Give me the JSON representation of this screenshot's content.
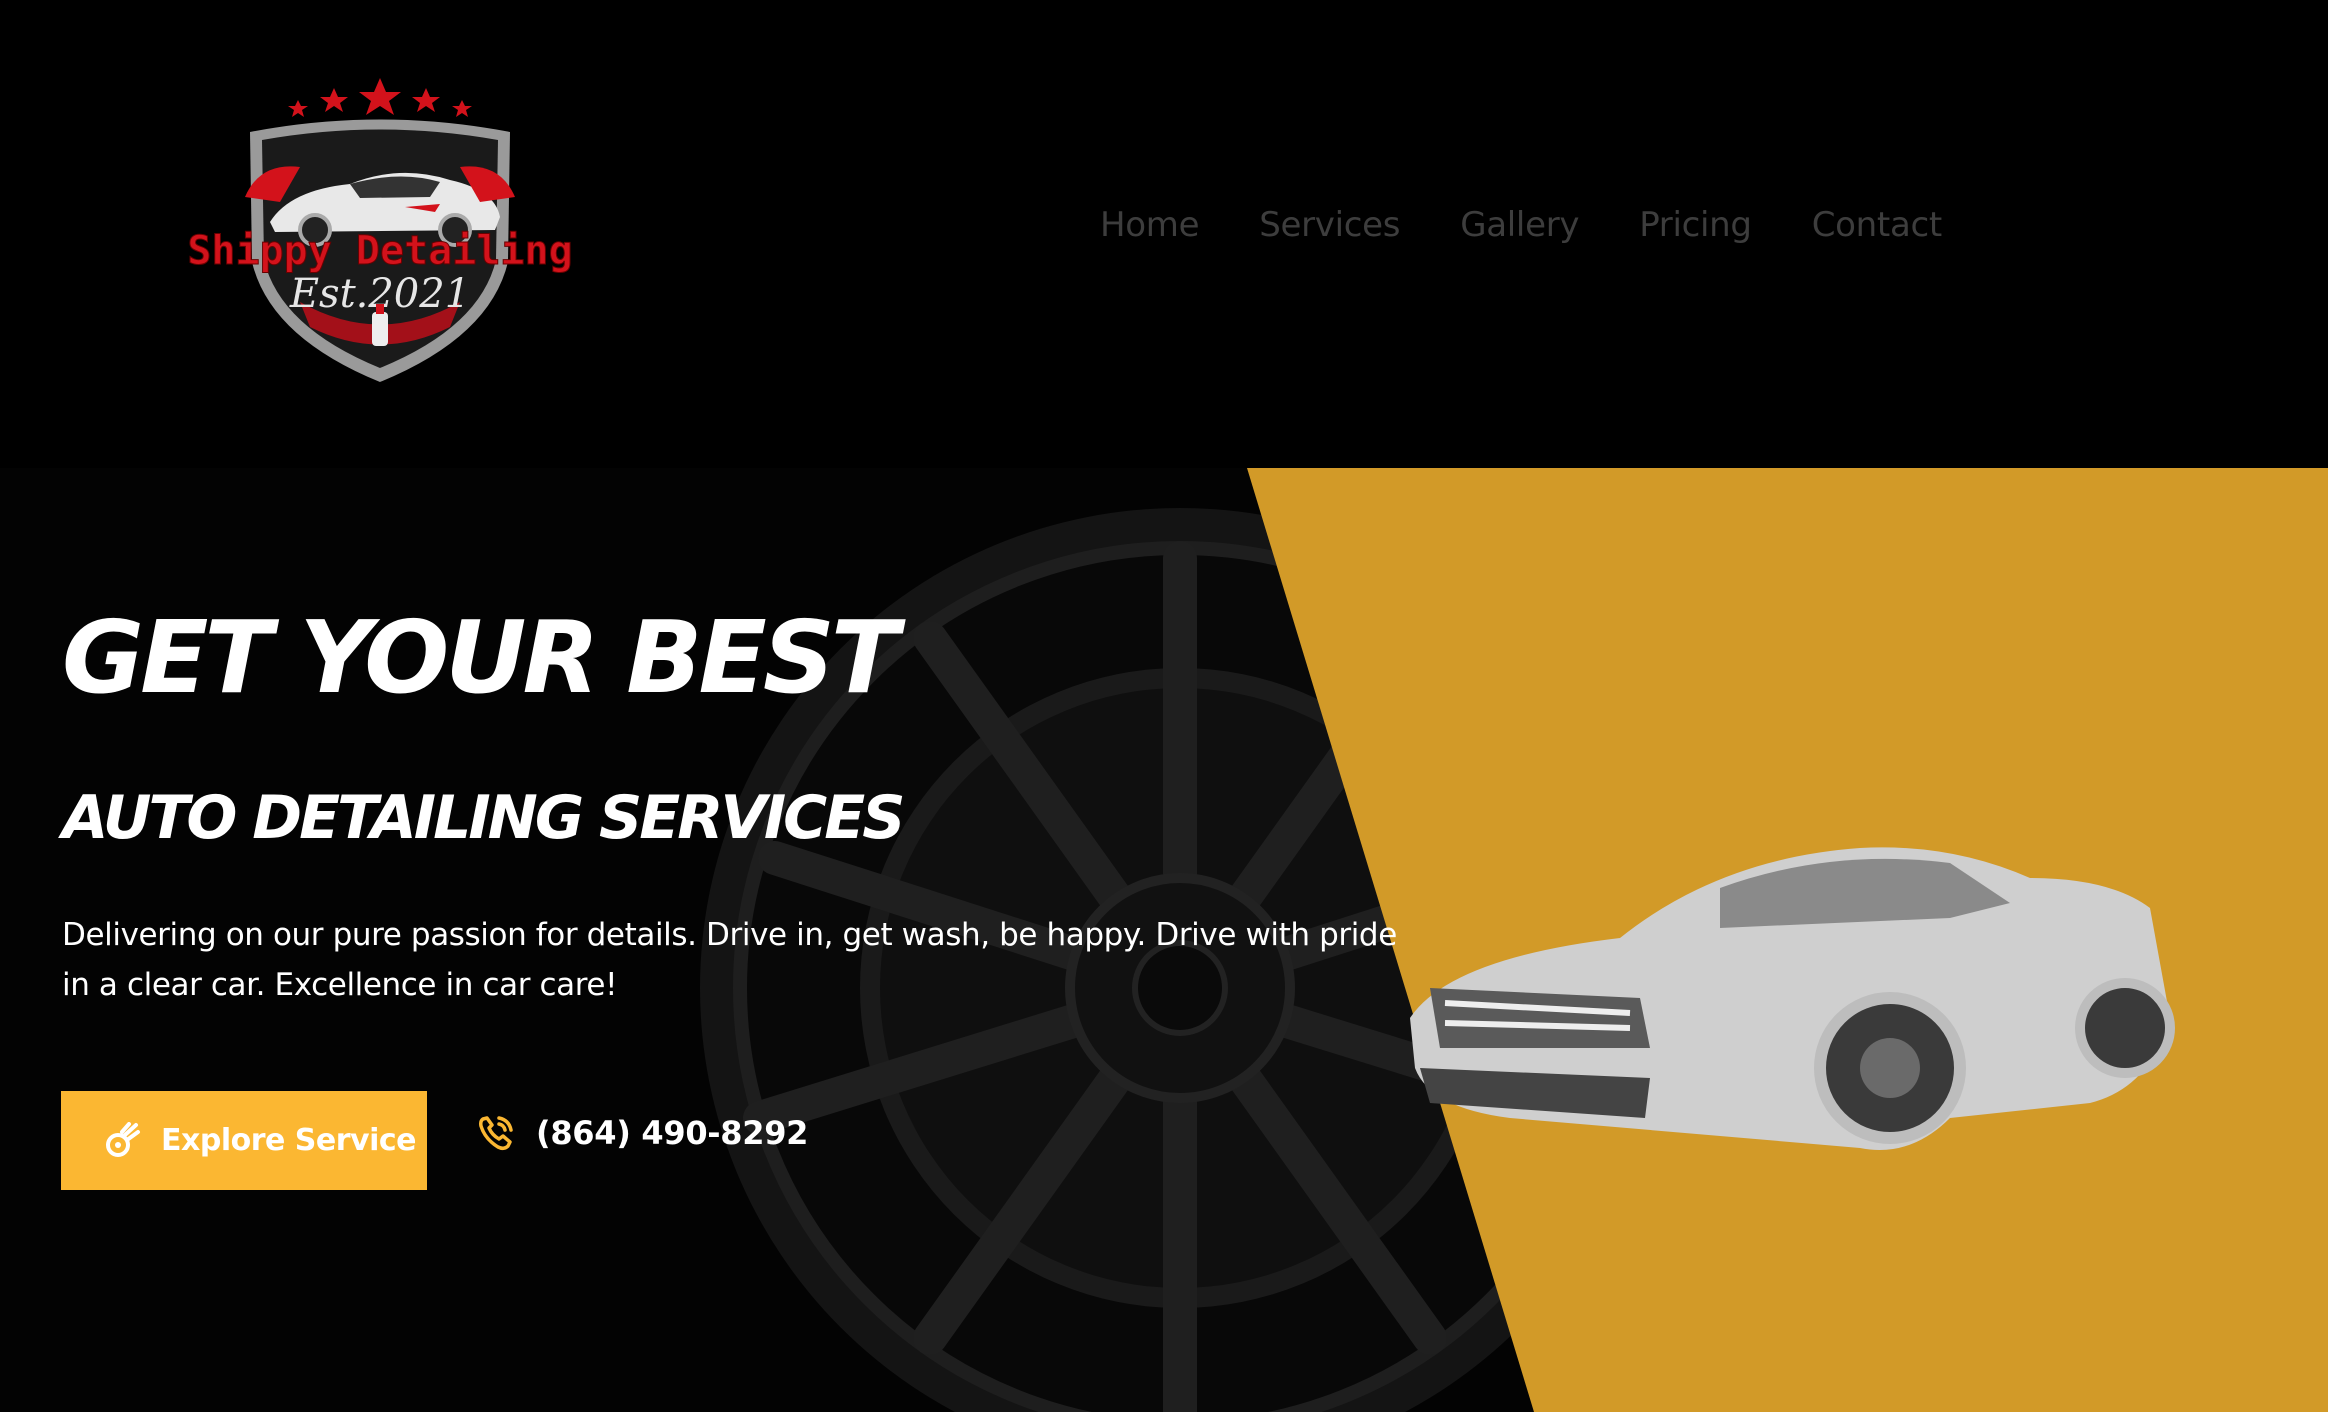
{
  "brand": {
    "logo_text": "Shippy Detailing",
    "logo_subtext": "Est.2021",
    "primary_red": "#d3121b",
    "accent_yellow": "#fbb732",
    "panel_yellow": "#d29a28"
  },
  "nav": {
    "items": [
      {
        "label": "Home"
      },
      {
        "label": "Services"
      },
      {
        "label": "Gallery"
      },
      {
        "label": "Pricing"
      },
      {
        "label": "Contact"
      }
    ]
  },
  "hero": {
    "headline": "GET YOUR BEST",
    "subheadline": "AUTO DETAILING SERVICES",
    "description": "Delivering on our pure passion for details. Drive in, get wash, be happy. Drive with pride in a clear car. Excellence in car care!",
    "cta_label": "Explore Service",
    "cta_icon": "comet-icon",
    "phone_icon": "phone-ringing-icon",
    "phone": "(864) 490-8292"
  }
}
